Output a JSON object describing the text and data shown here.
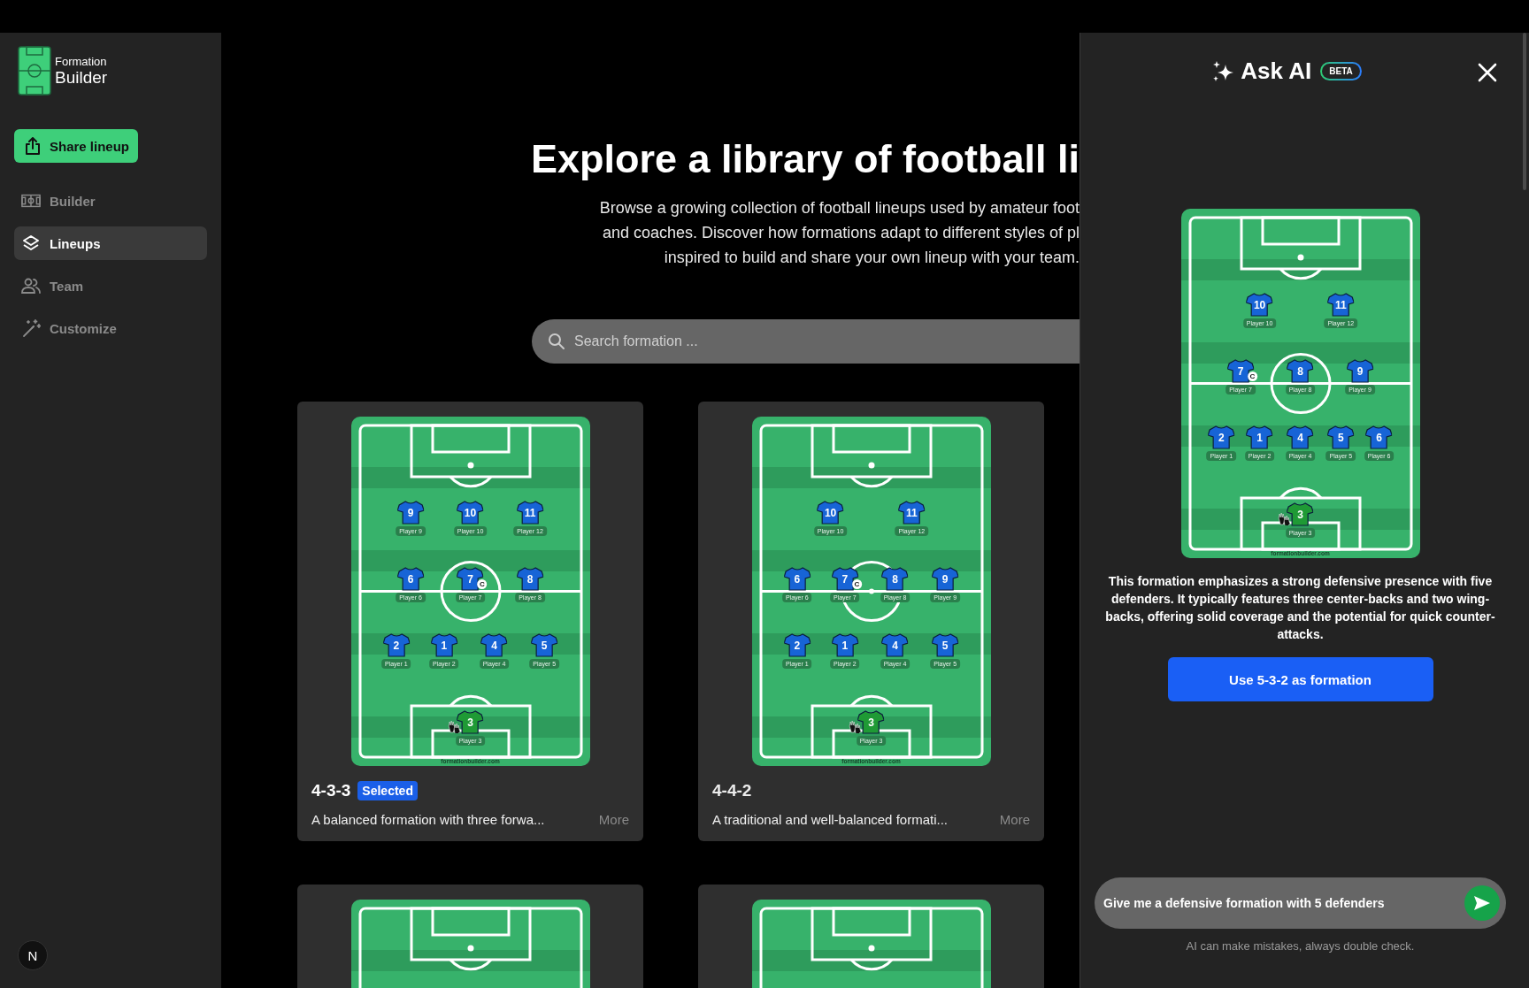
{
  "sidebar": {
    "logo": {
      "small": "Formation",
      "large": "Builder"
    },
    "share_button": "Share lineup",
    "items": [
      {
        "label": "Builder",
        "selected": false
      },
      {
        "label": "Lineups",
        "selected": true
      },
      {
        "label": "Team",
        "selected": false
      },
      {
        "label": "Customize",
        "selected": false
      }
    ],
    "corner_badge": "N"
  },
  "main": {
    "heading": "Explore a library of football li",
    "description_lines": [
      "Browse a growing collection of football lineups used by amateur foot",
      "and coaches. Discover how formations adapt to different styles of pl",
      "inspired to build and share your own lineup with your team."
    ],
    "search": {
      "placeholder": "Search formation ..."
    },
    "cards": [
      {
        "kind": "full",
        "name": "4-3-3",
        "selected": true,
        "badge": "Selected",
        "description": "A balanced formation with three forwa...",
        "more": "More",
        "pitch": {
          "credit": "formationbuilder.com",
          "lines": [
            {
              "players": [
                {
                  "number": "9",
                  "name": "Player 9",
                  "kind": "outfield"
                },
                {
                  "number": "10",
                  "name": "Player 10",
                  "kind": "outfield"
                },
                {
                  "number": "11",
                  "name": "Player 12",
                  "kind": "outfield"
                }
              ]
            },
            {
              "players": [
                {
                  "number": "6",
                  "name": "Player 6",
                  "kind": "outfield"
                },
                {
                  "number": "7",
                  "name": "Player 7",
                  "kind": "outfield",
                  "badge": "C"
                },
                {
                  "number": "8",
                  "name": "Player 8",
                  "kind": "outfield"
                }
              ]
            },
            {
              "players": [
                {
                  "number": "2",
                  "name": "Player 1",
                  "kind": "outfield"
                },
                {
                  "number": "1",
                  "name": "Player 2",
                  "kind": "outfield"
                },
                {
                  "number": "4",
                  "name": "Player 4",
                  "kind": "outfield"
                },
                {
                  "number": "5",
                  "name": "Player 5",
                  "kind": "outfield"
                }
              ]
            },
            {
              "players": [
                {
                  "number": "3",
                  "name": "Player 3",
                  "kind": "goalkeeper"
                }
              ]
            }
          ]
        }
      },
      {
        "kind": "full",
        "name": "4-4-2",
        "selected": false,
        "description": "A traditional and well-balanced formati...",
        "more": "More",
        "pitch": {
          "credit": "formationbuilder.com",
          "lines": [
            {
              "players": [
                {
                  "number": "10",
                  "name": "Player 10",
                  "kind": "outfield"
                },
                {
                  "number": "11",
                  "name": "Player 12",
                  "kind": "outfield"
                }
              ]
            },
            {
              "players": [
                {
                  "number": "6",
                  "name": "Player 6",
                  "kind": "outfield"
                },
                {
                  "number": "7",
                  "name": "Player 7",
                  "kind": "outfield",
                  "badge": "C"
                },
                {
                  "number": "8",
                  "name": "Player 8",
                  "kind": "outfield"
                },
                {
                  "number": "9",
                  "name": "Player 9",
                  "kind": "outfield"
                }
              ]
            },
            {
              "players": [
                {
                  "number": "2",
                  "name": "Player 1",
                  "kind": "outfield"
                },
                {
                  "number": "1",
                  "name": "Player 2",
                  "kind": "outfield"
                },
                {
                  "number": "4",
                  "name": "Player 4",
                  "kind": "outfield"
                },
                {
                  "number": "5",
                  "name": "Player 5",
                  "kind": "outfield"
                }
              ]
            },
            {
              "players": [
                {
                  "number": "3",
                  "name": "Player 3",
                  "kind": "goalkeeper"
                }
              ]
            }
          ]
        }
      },
      {
        "kind": "preview"
      },
      {
        "kind": "preview"
      }
    ]
  },
  "ai_panel": {
    "title": "Ask AI",
    "beta": "BETA",
    "pitch": {
      "credit": "formationbuilder.com",
      "lines": [
        {
          "players": [
            {
              "number": "10",
              "name": "Player 10",
              "kind": "outfield"
            },
            {
              "number": "11",
              "name": "Player 12",
              "kind": "outfield"
            }
          ]
        },
        {
          "players": [
            {
              "number": "7",
              "name": "Player 7",
              "kind": "outfield",
              "badge": "C"
            },
            {
              "number": "8",
              "name": "Player 8",
              "kind": "outfield"
            },
            {
              "number": "9",
              "name": "Player 9",
              "kind": "outfield"
            }
          ]
        },
        {
          "players": [
            {
              "number": "2",
              "name": "Player 1",
              "kind": "outfield"
            },
            {
              "number": "1",
              "name": "Player 2",
              "kind": "outfield"
            },
            {
              "number": "4",
              "name": "Player 4",
              "kind": "outfield"
            },
            {
              "number": "5",
              "name": "Player 5",
              "kind": "outfield"
            },
            {
              "number": "6",
              "name": "Player 6",
              "kind": "outfield"
            }
          ]
        },
        {
          "players": [
            {
              "number": "3",
              "name": "Player 3",
              "kind": "goalkeeper"
            }
          ]
        }
      ]
    },
    "answer": "This formation emphasizes a strong defensive presence with five defenders. It typically features three center-backs and two wing-backs, offering solid coverage and the potential for quick counter-attacks.",
    "action_button": "Use 5-3-2 as formation",
    "prompt": {
      "value": "Give me a defensive formation with 5 defenders"
    },
    "disclaimer": "AI can make mistakes, always double check."
  }
}
